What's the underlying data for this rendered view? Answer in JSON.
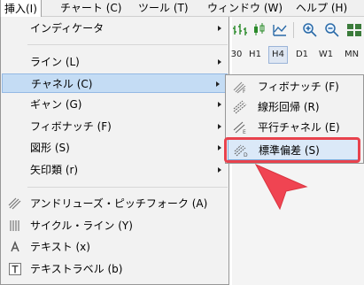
{
  "menubar": {
    "items": [
      {
        "label": "挿入(I)"
      },
      {
        "label": "チャート (C)"
      },
      {
        "label": "ツール (T)"
      },
      {
        "label": "ウィンドウ (W)"
      },
      {
        "label": "ヘルプ (H)"
      }
    ]
  },
  "toolbar": {
    "timeframes": [
      "30",
      "H1",
      "H4",
      "D1",
      "W1",
      "MN"
    ],
    "selected_timeframe": "H4"
  },
  "insert_menu": {
    "items": [
      {
        "label": "インディケータ"
      },
      {
        "label": "ライン (L)"
      },
      {
        "label": "チャネル (C)"
      },
      {
        "label": "ギャン (G)"
      },
      {
        "label": "フィボナッチ (F)"
      },
      {
        "label": "図形 (S)"
      },
      {
        "label": "矢印類 (r)"
      },
      {
        "label": "アンドリューズ・ピッチフォーク (A)"
      },
      {
        "label": "サイクル・ライン (Y)"
      },
      {
        "label": "テキスト (x)"
      },
      {
        "label": "テキストラベル (b)"
      }
    ]
  },
  "channel_submenu": {
    "items": [
      {
        "label": "フィボナッチ (F)"
      },
      {
        "label": "線形回帰 (R)"
      },
      {
        "label": "平行チャネル (E)"
      },
      {
        "label": "標準偏差 (S)"
      }
    ]
  },
  "colors": {
    "highlight_border": "#e8424d",
    "pointer": "#f04452"
  }
}
